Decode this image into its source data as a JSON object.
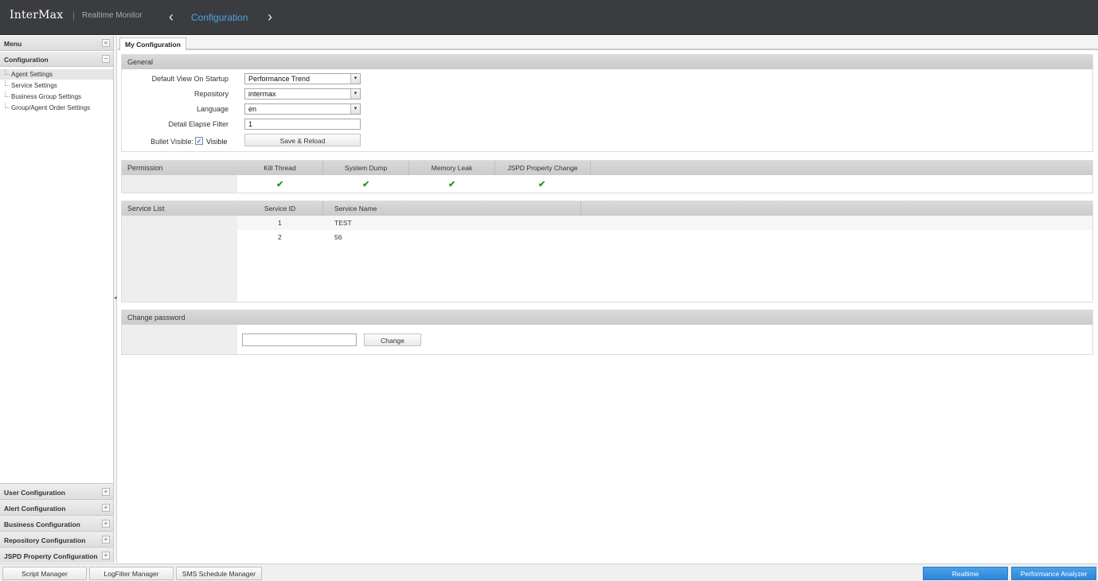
{
  "header": {
    "brand": "InterMax",
    "separator": "|",
    "subtitle": "Realtime Monitor",
    "prev_icon": "‹",
    "title": "Configuration",
    "next_icon": "›"
  },
  "sidebar": {
    "menu_label": "Menu",
    "collapse_icon": "«",
    "section_configuration": "Configuration",
    "section_configuration_toggle": "−",
    "items": [
      {
        "label": "Agent Settings"
      },
      {
        "label": "Service Settings"
      },
      {
        "label": "Business Group Settings"
      },
      {
        "label": "Group/Agent Order Settings"
      }
    ],
    "sections": [
      {
        "label": "User Configuration",
        "toggle": "+"
      },
      {
        "label": "Alert Configuration",
        "toggle": "+"
      },
      {
        "label": "Business Configuration",
        "toggle": "+"
      },
      {
        "label": "Repository Configuration",
        "toggle": "+"
      },
      {
        "label": "JSPD Property Configuration",
        "toggle": "+"
      }
    ]
  },
  "tabs": [
    {
      "label": "My Configuration"
    }
  ],
  "general": {
    "title": "General",
    "default_view_label": "Default View On Startup",
    "default_view_value": "Performance Trend",
    "repository_label": "Repository",
    "repository_value": "intermax",
    "language_label": "Language",
    "language_value": "en",
    "elapse_label": "Detail Elapse Filter",
    "elapse_value": "1",
    "bullet_label": "Bullet Visible:",
    "visible_label": "Visible",
    "visible_checked": "✓",
    "save_label": "Save & Reload",
    "dropdown_icon": "▾"
  },
  "permission": {
    "title": "Permission",
    "columns": [
      "Kill Thread",
      "System Dump",
      "Memory Leak",
      "JSPD Property Change"
    ],
    "check_icon": "✔"
  },
  "service_list": {
    "title": "Service List",
    "columns": [
      "Service ID",
      "Service Name"
    ],
    "rows": [
      {
        "id": "1",
        "name": "TEST"
      },
      {
        "id": "2",
        "name": "56"
      }
    ]
  },
  "change_password": {
    "title": "Change password",
    "input_value": "",
    "button_label": "Change"
  },
  "bottom_bar": {
    "script_manager": "Script Manager",
    "logfilter_manager": "LogFilter Manager",
    "sms_manager": "SMS Schedule Manager",
    "realtime": "Realtime",
    "performance_analyzer": "Performance Analyzer"
  },
  "splitter": {
    "arrow_icon": "◂"
  }
}
